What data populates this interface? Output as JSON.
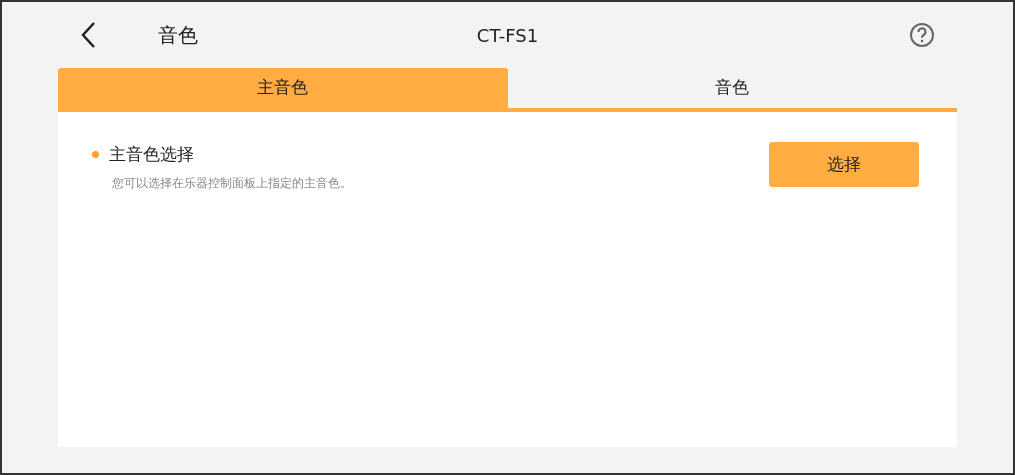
{
  "header": {
    "title": "音色",
    "device": "CT-FS1"
  },
  "tabs": [
    {
      "label": "主音色",
      "selected": true
    },
    {
      "label": "音色",
      "selected": false
    }
  ],
  "setting": {
    "title": "主音色选择",
    "description": "您可以选择在乐器控制面板上指定的主音色。",
    "button": "选择"
  }
}
